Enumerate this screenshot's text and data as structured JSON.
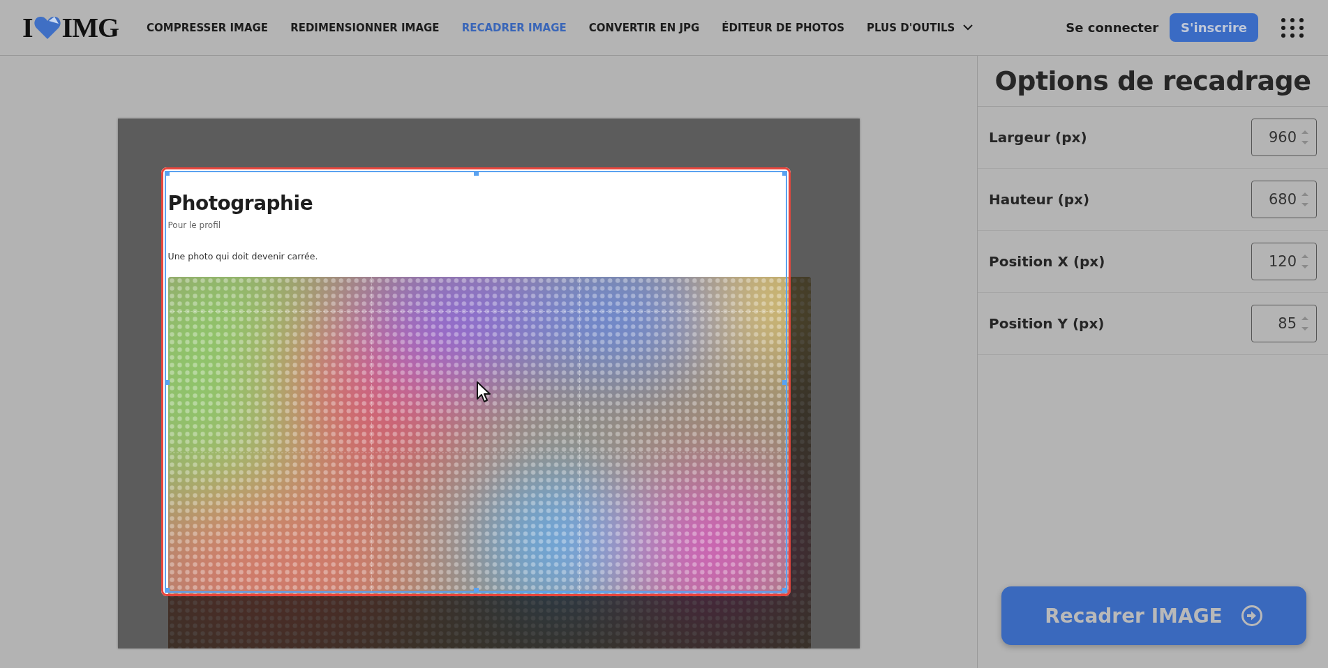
{
  "logo": {
    "text_before": "I",
    "text_after": "IMG"
  },
  "nav": [
    {
      "label": "COMPRESSER IMAGE",
      "selected": false,
      "kind": "link"
    },
    {
      "label": "REDIMENSIONNER IMAGE",
      "selected": false,
      "kind": "link"
    },
    {
      "label": "RECADRER IMAGE",
      "selected": true,
      "kind": "link"
    },
    {
      "label": "CONVERTIR EN JPG",
      "selected": false,
      "kind": "link"
    },
    {
      "label": "ÉDITEUR DE PHOTOS",
      "selected": false,
      "kind": "link"
    },
    {
      "label": "PLUS D'OUTILS",
      "selected": false,
      "kind": "dropdown"
    }
  ],
  "auth": {
    "login": "Se connecter",
    "signup": "S'inscrire"
  },
  "document": {
    "title": "Photographie",
    "subtitle": "Pour le profil",
    "text": "Une photo qui doit devenir carrée."
  },
  "panel": {
    "title": "Options de recadrage",
    "fields": [
      {
        "label": "Largeur (px)",
        "value": "960"
      },
      {
        "label": "Hauteur (px)",
        "value": "680"
      },
      {
        "label": "Position X (px)",
        "value": "120"
      },
      {
        "label": "Position Y (px)",
        "value": "85"
      }
    ],
    "action": "Recadrer IMAGE"
  }
}
